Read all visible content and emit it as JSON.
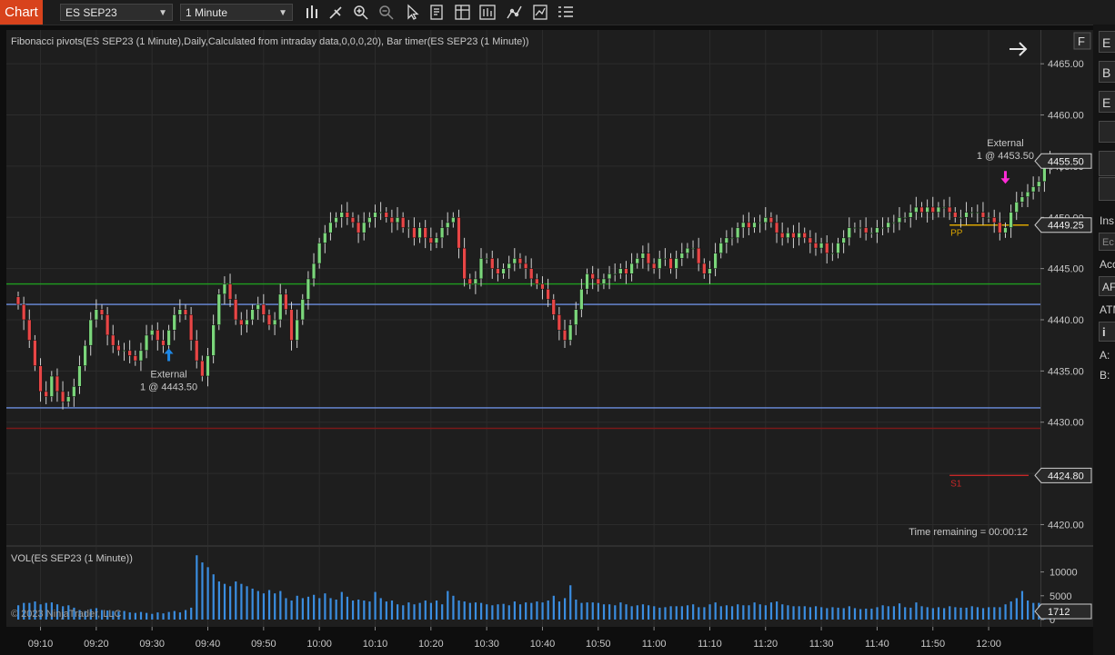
{
  "toolbar": {
    "tab_label": "Chart",
    "instrument": "ES SEP23",
    "interval": "1 Minute",
    "icons": [
      "bar-type-icon",
      "draw-pencil-icon",
      "zoom-in-icon",
      "zoom-out-icon",
      "pointer-icon",
      "properties-icon",
      "data-box-icon",
      "chart-trader-icon",
      "strategy-icon",
      "indicators-icon",
      "list-icon"
    ]
  },
  "panel": {
    "indicators_label": "Fibonacci pivots(ES SEP23 (1 Minute),Daily,Calculated from intraday data,0,0,0,20), Bar timer(ES SEP23 (1 Minute))",
    "f_button": "F",
    "arrow_icon": "arrow-right-icon",
    "time_remaining": "Time remaining = 00:00:12",
    "vol_label": "VOL(ES SEP23 (1 Minute))",
    "copyright": "© 2023 NinjaTrader, LLC"
  },
  "right_edge": {
    "boxes": [
      "E",
      "B",
      "E"
    ],
    "texts": [
      "Ins",
      "Ec",
      "Acc",
      "AF",
      "ATM",
      "i",
      "A:",
      "B:"
    ]
  },
  "chart_data": {
    "type": "candlestick",
    "instrument": "ES SEP23",
    "interval": "1 Minute",
    "y_ticks": [
      4465.0,
      4460.0,
      4455.0,
      4450.0,
      4445.0,
      4440.0,
      4435.0,
      4430.0,
      4425.0,
      4420.0
    ],
    "ylim": [
      4418.0,
      4468.3
    ],
    "x_ticks": [
      "09:10",
      "09:20",
      "09:30",
      "09:40",
      "09:50",
      "10:00",
      "10:10",
      "10:20",
      "10:30",
      "10:40",
      "10:50",
      "11:00",
      "11:10",
      "11:20",
      "11:30",
      "11:40",
      "11:50",
      "12:00"
    ],
    "x_start_minute": 546,
    "x_end_minute": 727,
    "closes": [
      4441.5,
      4440.0,
      4438.0,
      4435.5,
      4433.0,
      4432.5,
      4434.5,
      4433.0,
      4432.0,
      4432.5,
      4433.5,
      4435.5,
      4437.5,
      4440.0,
      4441.0,
      4440.5,
      4438.5,
      4437.5,
      4437.0,
      4437.0,
      4436.5,
      4436.0,
      4437.0,
      4438.5,
      4439.0,
      4438.0,
      4437.5,
      4439.0,
      4440.5,
      4441.0,
      4440.5,
      4438.0,
      4436.0,
      4434.5,
      4436.5,
      4439.5,
      4442.5,
      4443.5,
      4442.0,
      4440.0,
      4439.5,
      4440.0,
      4441.0,
      4441.5,
      4440.5,
      4439.5,
      4440.0,
      4442.5,
      4441.0,
      4438.0,
      4440.0,
      4442.0,
      4444.0,
      4445.5,
      4447.5,
      4448.5,
      4449.5,
      4450.0,
      4450.5,
      4450.0,
      4449.5,
      4448.5,
      4449.5,
      4450.0,
      4450.5,
      4450.5,
      4450.0,
      4449.5,
      4450.0,
      4449.0,
      4449.0,
      4448.0,
      4449.0,
      4448.0,
      4447.5,
      4448.0,
      4449.0,
      4449.5,
      4450.0,
      4447.0,
      4444.0,
      4443.5,
      4444.0,
      4446.0,
      4446.0,
      4445.0,
      4444.5,
      4445.0,
      4445.5,
      4446.0,
      4445.5,
      4445.0,
      4444.0,
      4443.5,
      4443.0,
      4442.0,
      4440.5,
      4439.0,
      4438.0,
      4439.5,
      4441.0,
      4443.0,
      4444.5,
      4444.0,
      4443.5,
      4444.0,
      4444.5,
      4444.5,
      4445.0,
      4444.5,
      4445.5,
      4446.0,
      4446.5,
      4445.5,
      4445.0,
      4446.0,
      4446.0,
      4445.0,
      4446.0,
      4446.5,
      4447.0,
      4447.0,
      4445.5,
      4444.5,
      4445.0,
      4446.5,
      4447.5,
      4448.0,
      4448.0,
      4449.0,
      4449.5,
      4449.0,
      4449.5,
      4449.5,
      4450.0,
      4449.5,
      4448.5,
      4448.0,
      4448.5,
      4448.0,
      4448.5,
      4448.0,
      4447.5,
      4447.0,
      4447.5,
      4446.5,
      4446.5,
      4447.5,
      4448.0,
      4449.0,
      4449.0,
      4449.0,
      4448.5,
      4448.5,
      4449.0,
      4449.0,
      4449.5,
      4449.5,
      4450.0,
      4450.0,
      4450.5,
      4451.0,
      4450.5,
      4451.0,
      4450.5,
      4451.0,
      4451.0,
      4450.5,
      4450.0,
      4450.0,
      4450.5,
      4450.5,
      4450.5,
      4450.0,
      4450.0,
      4449.5,
      4448.5,
      4449.0,
      4450.5,
      4451.5,
      4452.0,
      4452.5,
      4453.0,
      4453.5,
      4455.0,
      4455.5,
      4455.5,
      4455.5
    ],
    "vol_y_ticks": [
      10000,
      5000,
      0
    ],
    "vol_ylim": [
      0,
      14500
    ],
    "volumes": [
      3000,
      3500,
      3500,
      3800,
      3200,
      3500,
      3600,
      3200,
      2800,
      3000,
      2500,
      2000,
      1800,
      2200,
      2400,
      2000,
      1900,
      1800,
      1700,
      1800,
      1500,
      1400,
      1600,
      1400,
      1200,
      1500,
      1300,
      1600,
      1800,
      1500,
      2000,
      2500,
      13500,
      12000,
      11000,
      9500,
      8000,
      7500,
      7000,
      8000,
      7500,
      7000,
      6500,
      6000,
      5500,
      6200,
      5500,
      6000,
      4500,
      4000,
      5000,
      4500,
      4800,
      5200,
      4500,
      5500,
      4500,
      4200,
      5800,
      4800,
      4000,
      4200,
      4000,
      3800,
      5800,
      4500,
      3800,
      4000,
      3200,
      3000,
      3600,
      3200,
      3500,
      4000,
      3500,
      4000,
      3200,
      6000,
      5000,
      4000,
      3800,
      3500,
      3600,
      3500,
      3200,
      3000,
      3200,
      3300,
      3000,
      3800,
      3200,
      3600,
      3500,
      3800,
      3600,
      4000,
      5000,
      3800,
      4500,
      7200,
      4200,
      3500,
      3600,
      3600,
      3500,
      3200,
      3200,
      3000,
      3600,
      3200,
      2800,
      3000,
      3200,
      3000,
      2800,
      2500,
      2600,
      2800,
      2800,
      2800,
      3000,
      3200,
      2600,
      2600,
      3200,
      3600,
      2800,
      3000,
      2800,
      3200,
      3000,
      3000,
      3600,
      3200,
      3000,
      3600,
      3800,
      3200,
      3000,
      2800,
      2800,
      2800,
      2600,
      2800,
      2600,
      2400,
      2600,
      2500,
      2400,
      2800,
      2400,
      2200,
      2300,
      2300,
      2600,
      3000,
      2800,
      2800,
      3400,
      2600,
      2500,
      3600,
      2800,
      2600,
      2400,
      2600,
      2400,
      2800,
      2600,
      2500,
      2500,
      2800,
      2600,
      2400,
      2600,
      2600,
      2600,
      3200,
      3800,
      4500,
      6000,
      4000,
      3500,
      3500,
      3000,
      1712
    ],
    "levels": [
      {
        "name": "PP",
        "value": 4449.25,
        "color": "#d9a400",
        "label_from_minute": 713
      },
      {
        "name": "S1",
        "value": 4424.8,
        "color": "#c62828",
        "label_from_minute": 713
      },
      {
        "name": "",
        "value": 4443.5,
        "color": "#1f9e1f"
      },
      {
        "name": "",
        "value": 4441.5,
        "color": "#6d8fe0"
      },
      {
        "name": "",
        "value": 4431.4,
        "color": "#6d8fe0"
      },
      {
        "name": "",
        "value": 4429.4,
        "color": "#7a1818"
      }
    ],
    "price_markers": [
      {
        "label": "4455.50",
        "value": 4455.5,
        "style": "current"
      },
      {
        "label": "4449.25",
        "value": 4449.25,
        "style": "level"
      },
      {
        "label": "4424.80",
        "value": 4424.8,
        "style": "level"
      }
    ],
    "volume_marker": {
      "label": "1712",
      "value": 1712
    },
    "executions": [
      {
        "side": "buy",
        "minute": 573,
        "price": 4436.5,
        "line1": "External",
        "line2": "1 @ 4443.50",
        "color": "#1e88e5"
      },
      {
        "side": "sell",
        "minute": 723,
        "price": 4454.0,
        "line1": "External",
        "line2": "1 @ 4453.50",
        "color": "#ff2bd6"
      }
    ],
    "up_color": "#7bd67b",
    "down_color": "#e84646",
    "volume_color": "#3a8de0"
  }
}
